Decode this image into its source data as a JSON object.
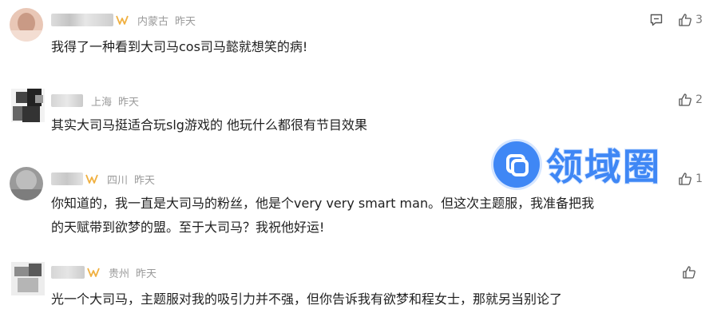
{
  "comments": [
    {
      "location": "内蒙古",
      "time": "昨天",
      "text": "我得了一种看到大司马cos司马懿就想笑的病!",
      "likes": "3"
    },
    {
      "location": "上海",
      "time": "昨天",
      "text": "其实大司马挺适合玩slg游戏的 他玩什么都很有节目效果",
      "likes": "2"
    },
    {
      "location": "四川",
      "time": "昨天",
      "text_line1": "你知道的，我一直是大司马的粉丝，他是个very very smart man。但这次主题服，我准备把我",
      "text_line2": "的天赋带到欲梦的盟。至于大司马？我祝他好运!",
      "likes": "1"
    },
    {
      "location": "贵州",
      "time": "昨天",
      "text": "光一个大司马，主题服对我的吸引力并不强，但你告诉我有欲梦和程女士，那就另当别论了",
      "likes": ""
    }
  ],
  "watermark": {
    "text": "领域圈"
  },
  "colors": {
    "meta": "#9a9a9a",
    "vip": "#f0b040",
    "watermark": "#3f87f5"
  },
  "icons": [
    "reply-icon",
    "thumbs-up-icon",
    "vip-badge-icon"
  ]
}
